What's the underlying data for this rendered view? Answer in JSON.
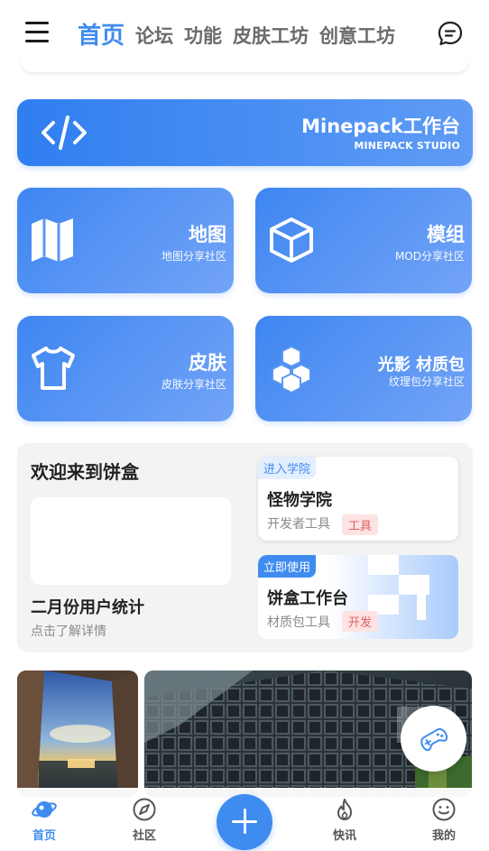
{
  "topnav": {
    "tabs": [
      {
        "label": "首页",
        "active": true
      },
      {
        "label": "论坛",
        "active": false
      },
      {
        "label": "功能",
        "active": false
      },
      {
        "label": "皮肤工坊",
        "active": false
      },
      {
        "label": "创意工坊",
        "active": false
      }
    ],
    "menu_icon": "hamburger-menu-icon",
    "message_icon": "chat-bubble-icon"
  },
  "banner": {
    "title": "Minepack工作台",
    "subtitle": "MINEPACK STUDIO",
    "icon": "code-brackets-icon"
  },
  "categories": [
    {
      "title": "地图",
      "subtitle": "地图分享社区",
      "icon": "map-icon"
    },
    {
      "title": "模组",
      "subtitle": "MOD分享社区",
      "icon": "cube-icon"
    },
    {
      "title": "皮肤",
      "subtitle": "皮肤分享社区",
      "icon": "tshirt-icon"
    },
    {
      "title": "光影 材质包",
      "subtitle": "纹理包分享社区",
      "icon": "stacked-cubes-icon"
    }
  ],
  "welcome": {
    "title": "欢迎来到饼盒",
    "stats_title": "二月份用户统计",
    "stats_sub": "点击了解详情",
    "academy": {
      "badge": "进入学院",
      "title": "怪物学院",
      "subtitle": "开发者工具",
      "tag": "工具"
    },
    "studio": {
      "badge": "立即使用",
      "title": "饼盒工作台",
      "subtitle": "材质包工具",
      "tag": "开发"
    }
  },
  "fab_icon": "gamepad-icon",
  "bottomnav": {
    "items": [
      {
        "label": "首页",
        "icon": "planet-icon",
        "active": true
      },
      {
        "label": "社区",
        "icon": "compass-icon",
        "active": false
      },
      {
        "label": "快讯",
        "icon": "flame-icon",
        "active": false
      },
      {
        "label": "我的",
        "icon": "smiley-icon",
        "active": false
      }
    ],
    "center_icon": "plus-icon"
  },
  "colors": {
    "accent": "#3f8cf0",
    "tag_red": "#e06060",
    "panel_bg": "#f3f3f3"
  }
}
